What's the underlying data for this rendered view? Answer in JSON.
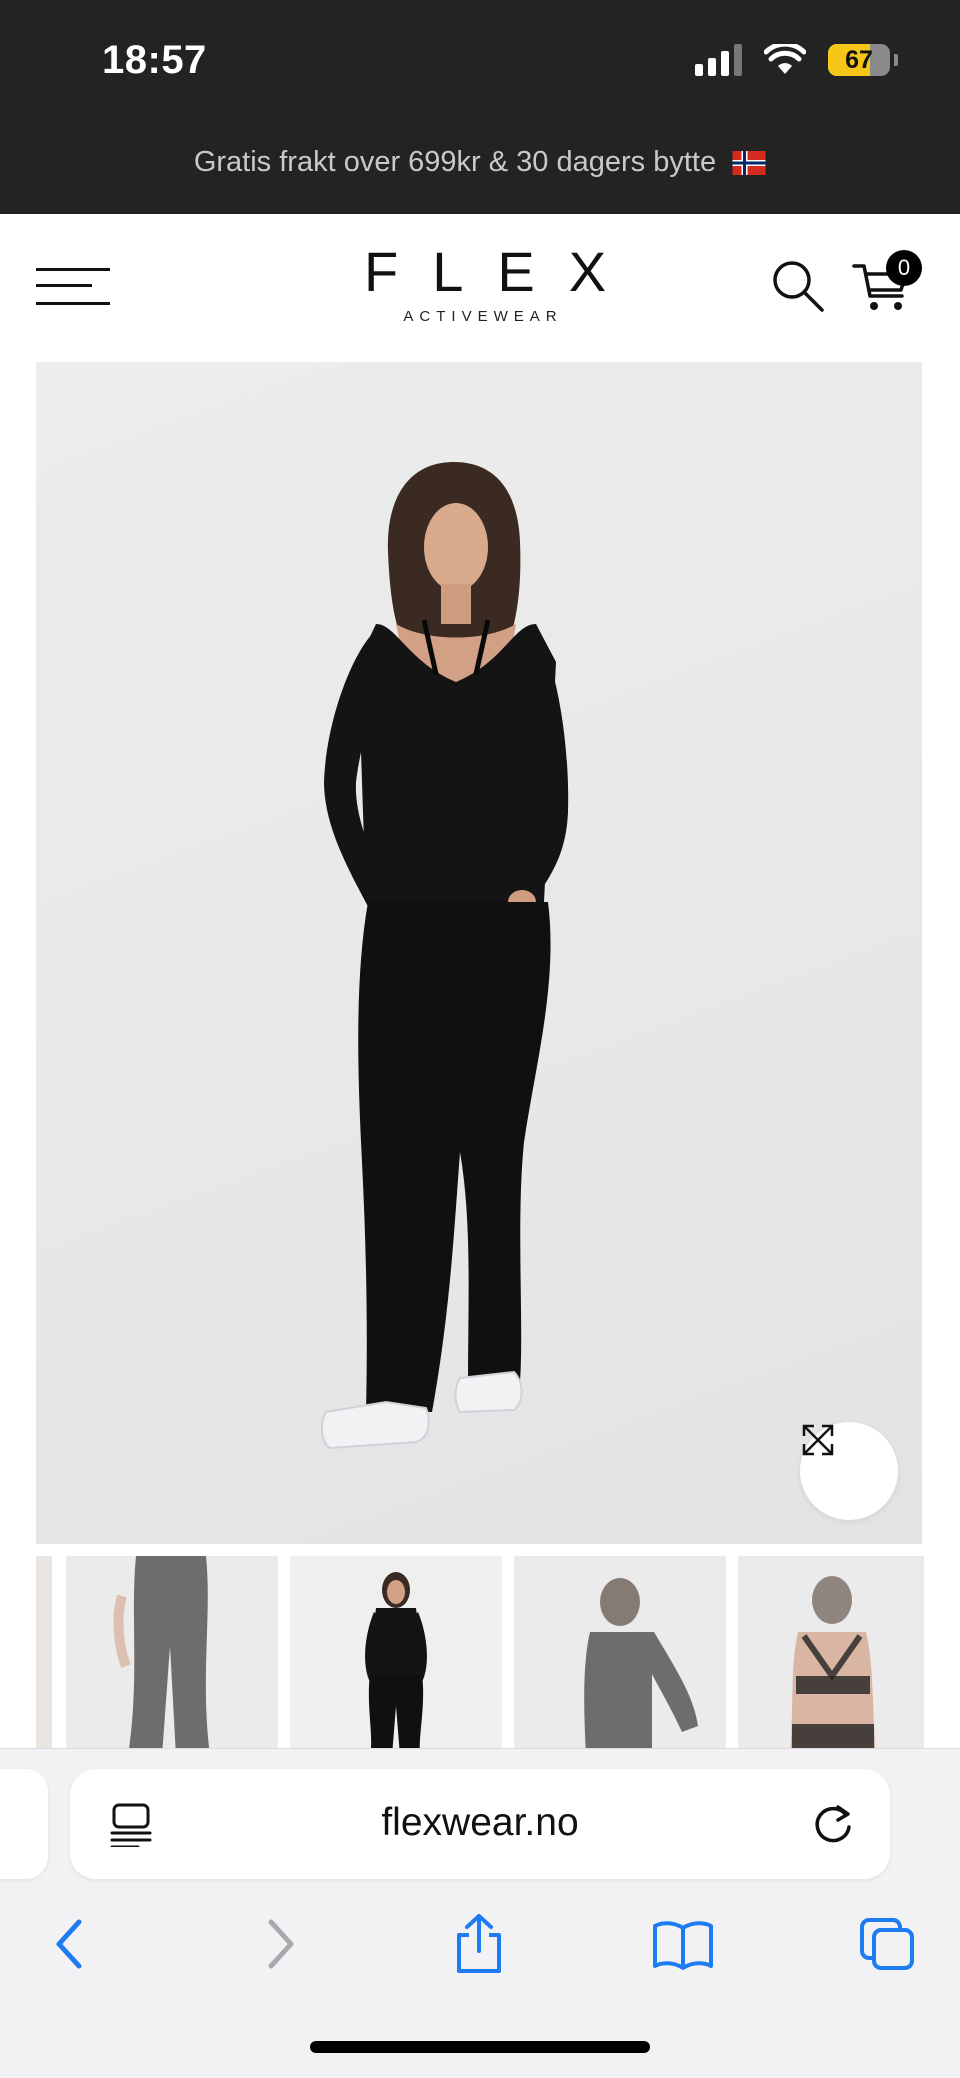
{
  "status_bar": {
    "time": "18:57",
    "battery": "67",
    "battery_level": 0.67
  },
  "promo": {
    "text": "Gratis frakt over 699kr & 30 dagers bytte"
  },
  "header": {
    "logo_main": "FLEX",
    "logo_sub": "ACTIVEWEAR",
    "cart_count": "0"
  },
  "product_gallery": {
    "thumbnails": [
      "leggings-back-view",
      "full-outfit-front",
      "top-side-view",
      "bra-back-view"
    ]
  },
  "browser": {
    "url": "flexwear.no"
  },
  "icons": [
    "menu-icon",
    "search-icon",
    "cart-icon",
    "expand-icon",
    "reader-icon",
    "reload-icon",
    "back-icon",
    "forward-icon",
    "share-icon",
    "bookmarks-icon",
    "tabs-icon"
  ],
  "colors": {
    "accent": "#1e7cf2",
    "header_bg": "#232323"
  }
}
